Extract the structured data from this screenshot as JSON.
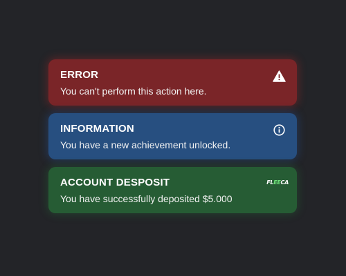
{
  "notifications": [
    {
      "type": "error",
      "title": "ERROR",
      "message": "You can't perform this action here.",
      "icon": "warning-icon",
      "color": "#7a2528"
    },
    {
      "type": "info",
      "title": "INFORMATION",
      "message": "You have a new achievement unlocked.",
      "icon": "info-icon",
      "color": "#274f80"
    },
    {
      "type": "deposit",
      "title": "ACCOUNT DESPOSIT",
      "message": "You have successfully deposited $5.000",
      "icon": "fleeca-logo",
      "logo_text": "FLEECA",
      "color": "#265c34"
    }
  ]
}
